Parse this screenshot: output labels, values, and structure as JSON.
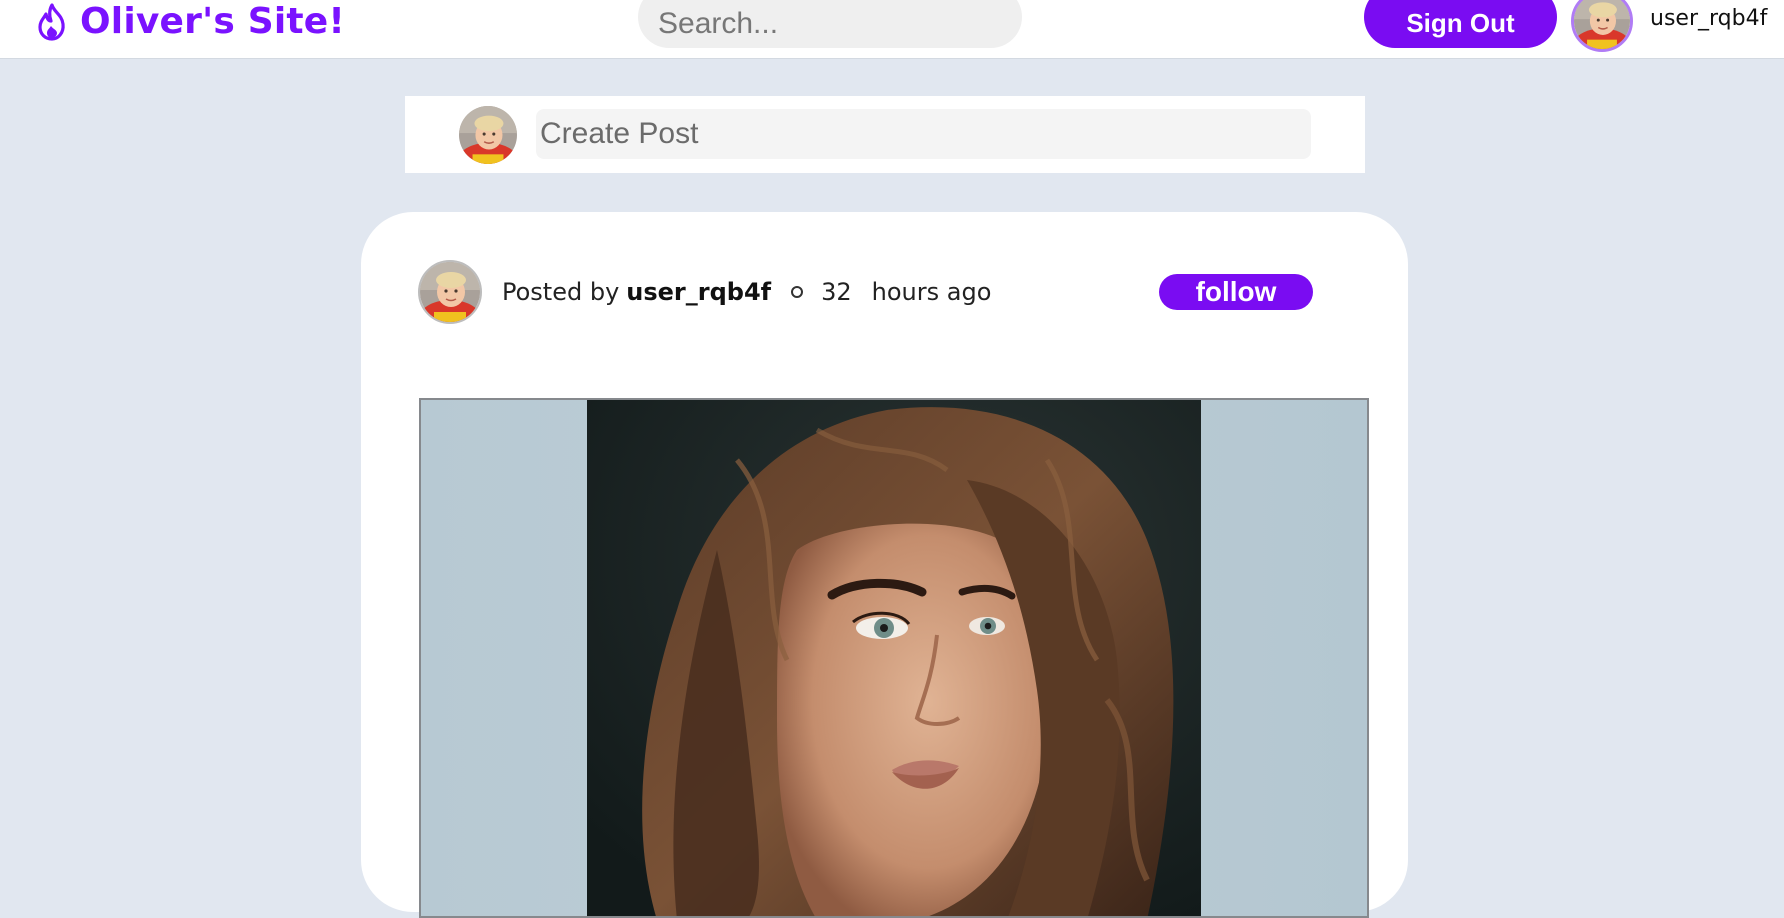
{
  "header": {
    "brand_title": "Oliver's Site!",
    "brand_icon": "flame-icon",
    "search_placeholder": "Search...",
    "signout_label": "Sign Out",
    "username": "user_rqb4f"
  },
  "create_post": {
    "placeholder": "Create Post"
  },
  "post": {
    "posted_by_label": "Posted by",
    "author": "user_rqb4f",
    "time_value": "32",
    "time_unit": "hours ago",
    "follow_label": "follow"
  },
  "colors": {
    "accent": "#7a0cf2",
    "background": "#e1e7f0",
    "card": "#ffffff"
  }
}
